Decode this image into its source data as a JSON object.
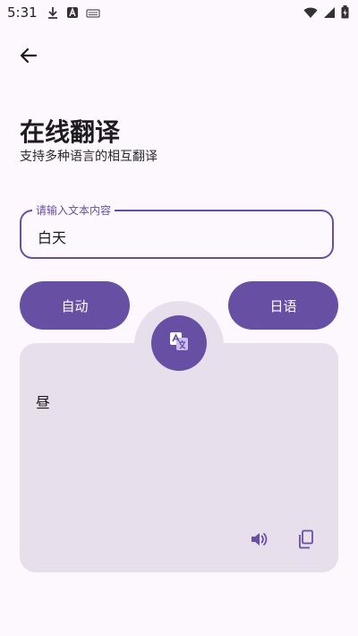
{
  "status_bar": {
    "time": "5:31",
    "left_icons": [
      "download-icon",
      "a-box-icon",
      "keyboard-icon"
    ],
    "right_icons": [
      "wifi-icon",
      "signal-icon",
      "battery-icon"
    ]
  },
  "toolbar": {
    "back_icon": "back-arrow-icon"
  },
  "header": {
    "title": "在线翻译",
    "subtitle": "支持多种语言的相互翻译"
  },
  "input": {
    "label": "请输入文本内容",
    "value": "白天"
  },
  "languages": {
    "source": "自动",
    "target": "日语"
  },
  "result": {
    "text": "昼",
    "actions": [
      "speaker-icon",
      "copy-icon"
    ]
  },
  "colors": {
    "accent": "#6750a4",
    "background": "#fdf7fe",
    "card": "#e7e0ec"
  }
}
